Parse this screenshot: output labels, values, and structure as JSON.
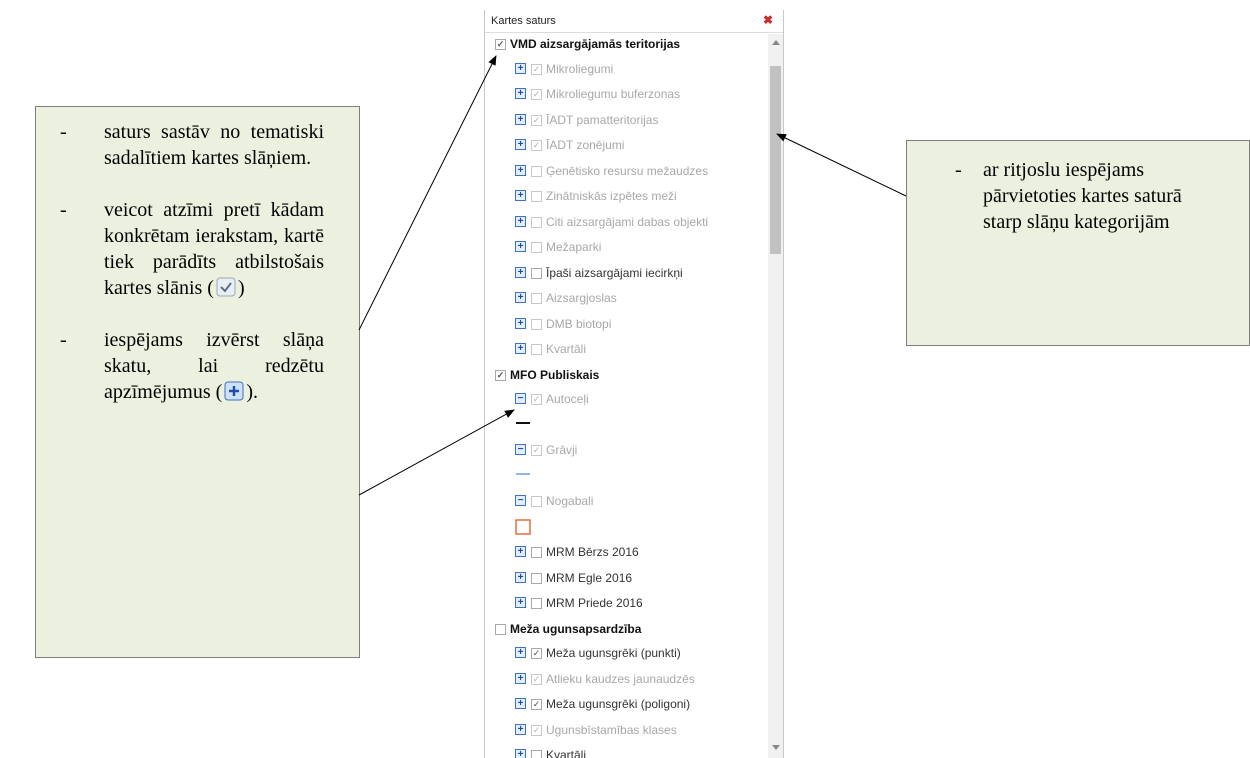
{
  "panel": {
    "title": "Kartes saturs",
    "close_icon": "close-icon"
  },
  "groups": [
    {
      "label": "VMD aizsargājamās teritorijas",
      "checked": true,
      "layers": [
        {
          "label": "Mikroliegumi",
          "checked": true,
          "disabled": true
        },
        {
          "label": "Mikroliegumu buferzonas",
          "checked": true,
          "disabled": true
        },
        {
          "label": "ĪADT pamatteritorijas",
          "checked": true,
          "disabled": true
        },
        {
          "label": "ĪADT zonējumi",
          "checked": true,
          "disabled": true
        },
        {
          "label": "Ģenētisko resursu mežaudzes",
          "checked": false,
          "disabled": true
        },
        {
          "label": "Zinātniskās izpētes meži",
          "checked": false,
          "disabled": true
        },
        {
          "label": "Citi aizsargājami dabas objekti",
          "checked": false,
          "disabled": true
        },
        {
          "label": "Mežaparki",
          "checked": false,
          "disabled": true
        },
        {
          "label": "Īpaši aizsargājami iecirkņi",
          "checked": false,
          "disabled": false
        },
        {
          "label": "Aizsargjoslas",
          "checked": false,
          "disabled": true
        },
        {
          "label": "DMB biotopi",
          "checked": false,
          "disabled": true
        },
        {
          "label": "Kvartāli",
          "checked": false,
          "disabled": true
        }
      ]
    },
    {
      "label": "MFO Publiskais",
      "checked": true,
      "layers": [
        {
          "label": "Autoceļi",
          "checked": true,
          "disabled": true,
          "expanded": true,
          "legend": "black-line"
        },
        {
          "label": "Grāvji",
          "checked": true,
          "disabled": true,
          "expanded": true,
          "legend": "blue-line"
        },
        {
          "label": "Nogabali",
          "checked": false,
          "disabled": true,
          "expanded": true,
          "legend": "orange-square"
        },
        {
          "label": "MRM Bērzs 2016",
          "checked": false,
          "disabled": false
        },
        {
          "label": "MRM Egle 2016",
          "checked": false,
          "disabled": false
        },
        {
          "label": "MRM Priede 2016",
          "checked": false,
          "disabled": false
        }
      ]
    },
    {
      "label": "Meža ugunsapsardzība",
      "checked": false,
      "layers": [
        {
          "label": "Meža ugunsgrēki (punkti)",
          "checked": true,
          "disabled": false
        },
        {
          "label": "Atlieku kaudzes jaunaudzēs",
          "checked": true,
          "disabled": true
        },
        {
          "label": "Meža ugunsgrēki (poligoni)",
          "checked": true,
          "disabled": false
        },
        {
          "label": "Ugunsbīstamības klases",
          "checked": true,
          "disabled": true
        },
        {
          "label": "Kvartāli",
          "checked": false,
          "disabled": false
        }
      ]
    }
  ],
  "callout_left": {
    "items": [
      {
        "dash": "-",
        "text": "saturs sastāv no tematiski sadalītiem kartes slāņiem."
      },
      {
        "dash": "-",
        "text": "veicot atzīmi pretī kādam konkrētam ierakstam, kartē tiek parādīts atbilstošais kartes slānis (",
        "suffix": ")",
        "icon": "checkbox-checked-icon"
      },
      {
        "dash": "-",
        "text": "iespējams izvērst slāņa skatu, lai redzētu apzīmējumus (",
        "suffix": ").",
        "icon": "expand-plus-icon"
      }
    ]
  },
  "callout_right": {
    "items": [
      {
        "dash": "-",
        "text": "ar ritjoslu iespējams pārvietoties kartes saturā starp slāņu kategorijām"
      }
    ]
  }
}
